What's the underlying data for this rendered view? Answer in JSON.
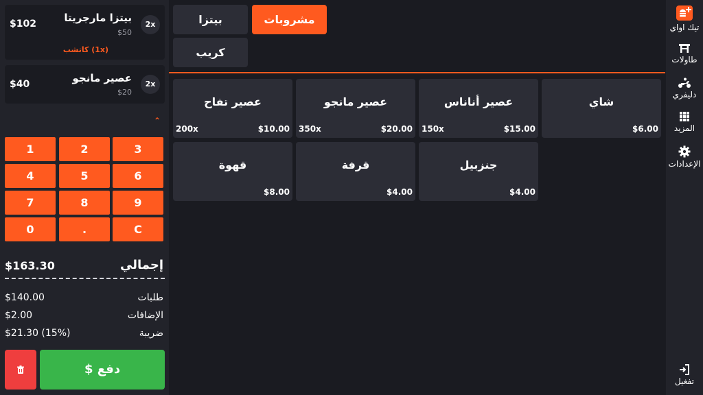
{
  "nav": {
    "brand_label": "تيك اواي",
    "tables_label": "طاولات",
    "delivery_label": "دليفري",
    "more_label": "المزيد",
    "settings_label": "الإعدادات",
    "logout_label": "تفغيل"
  },
  "order": {
    "items": [
      {
        "name": "بيتزا مارجريتا",
        "unit_price": "$50",
        "total": "$102",
        "qty": "2x",
        "extra": "كاتشب (1x)"
      },
      {
        "name": "عصير مانجو",
        "unit_price": "$20",
        "total": "$40",
        "qty": "2x"
      }
    ]
  },
  "keypad": [
    "1",
    "2",
    "3",
    "4",
    "5",
    "6",
    "7",
    "8",
    "9",
    "0",
    ".",
    "C"
  ],
  "summary": {
    "total_label": "إجمالي",
    "total_value": "$163.30",
    "orders_label": "طلبات",
    "orders_value": "$140.00",
    "addons_label": "الإضافات",
    "addons_value": "$2.00",
    "tax_label": "ضريبة",
    "tax_value": "$21.30 (15%)"
  },
  "actions": {
    "pay_label": "$ دفع"
  },
  "categories": [
    {
      "label": "مشروبات",
      "active": true
    },
    {
      "label": "بيتزا",
      "active": false
    },
    {
      "label": "كريب",
      "active": false
    }
  ],
  "products": [
    {
      "name": "شاي",
      "price": "$6.00",
      "stock": ""
    },
    {
      "name": "عصير أناناس",
      "price": "$15.00",
      "stock": "150x"
    },
    {
      "name": "عصير مانجو",
      "price": "$20.00",
      "stock": "350x"
    },
    {
      "name": "عصير تفاح",
      "price": "$10.00",
      "stock": "200x"
    },
    {
      "name": "جنزبيل",
      "price": "$4.00",
      "stock": ""
    },
    {
      "name": "قرفة",
      "price": "$4.00",
      "stock": ""
    },
    {
      "name": "قهوة",
      "price": "$8.00",
      "stock": ""
    }
  ],
  "colors": {
    "accent": "#ff5a1f",
    "pay": "#39b54a",
    "delete": "#ef3e3e",
    "panel": "#22232a",
    "card": "#2c2d36"
  },
  "icons": [
    "takeaway-icon",
    "table-icon",
    "delivery-icon",
    "grid-icon",
    "gear-icon",
    "logout-icon",
    "trash-icon"
  ]
}
